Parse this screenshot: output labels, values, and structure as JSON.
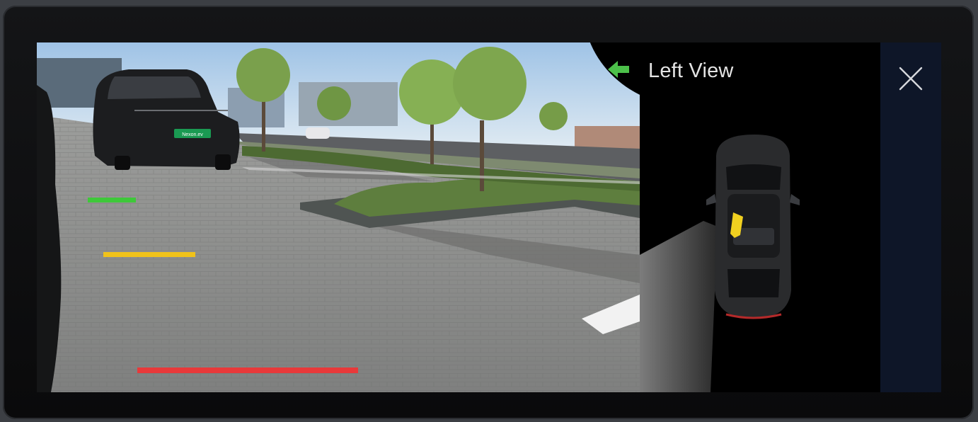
{
  "header": {
    "view_title": "Left View",
    "back_icon": "arrow-left-icon",
    "close_icon": "close-icon"
  },
  "camera_view": {
    "plate_text": "Nexon.ev",
    "guide_lines": [
      {
        "name": "near",
        "color": "#e8393a"
      },
      {
        "name": "mid",
        "color": "#f0c21a"
      },
      {
        "name": "far",
        "color": "#3ec83a"
      }
    ]
  },
  "colors": {
    "accent_arrow": "#4cc04a",
    "sensor_zone": "#f0d020",
    "close_column": "#0e1628",
    "title_text": "#e4e4e4"
  }
}
